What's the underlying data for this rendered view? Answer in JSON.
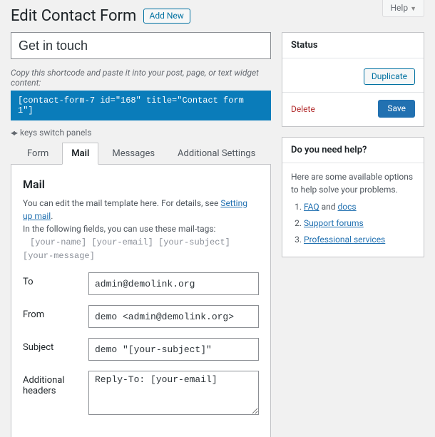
{
  "help_tab": "Help",
  "page_title": "Edit Contact Form",
  "add_new": "Add New",
  "form": {
    "title_value": "Get in touch",
    "copy_note": "Copy this shortcode and paste it into your post, page, or text widget content:",
    "shortcode": "[contact-form-7 id=\"168\" title=\"Contact form 1\"]",
    "keys_switch": "keys switch panels"
  },
  "tabs": {
    "form": "Form",
    "mail": "Mail",
    "messages": "Messages",
    "additional": "Additional Settings"
  },
  "mail": {
    "heading": "Mail",
    "desc_prefix": "You can edit the mail template here. For details, see ",
    "desc_link": "Setting up mail",
    "desc_suffix": ".",
    "tags_note": "In the following fields, you can use these mail-tags:",
    "tags": "[your-name] [your-email] [your-subject] [your-message]",
    "to_label": "To",
    "to_value": "admin@demolink.org",
    "from_label": "From",
    "from_value": "demo <admin@demolink.org>",
    "subject_label": "Subject",
    "subject_value": "demo \"[your-subject]\"",
    "addhdr_label": "Additional headers",
    "addhdr_value": "Reply-To: [your-email]"
  },
  "status": {
    "heading": "Status",
    "duplicate": "Duplicate",
    "delete": "Delete",
    "save": "Save"
  },
  "help": {
    "heading": "Do you need help?",
    "intro": "Here are some available options to help solve your problems.",
    "faq_prefix": "FAQ",
    "faq_mid": " and ",
    "faq_docs": "docs",
    "support": "Support forums",
    "pro": "Professional services"
  }
}
